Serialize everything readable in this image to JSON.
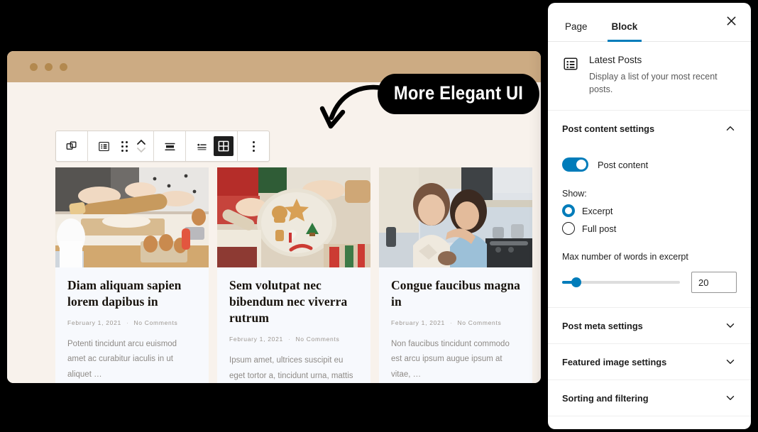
{
  "callout": {
    "text": "More Elegant UI",
    "arrow_icon": "curved-arrow-down-left-icon"
  },
  "browser": {
    "window_dots": [
      "dot-1",
      "dot-2",
      "dot-3"
    ],
    "titlebar_color": "#ccab83",
    "page_background": "#f8f2ec"
  },
  "toolbar": {
    "buttons": [
      {
        "name": "block-transform-button",
        "icon": "copy-blocks-icon"
      },
      {
        "name": "block-type-button",
        "icon": "list-view-icon"
      },
      {
        "name": "drag-handle-button",
        "icon": "drag-dots-icon"
      },
      {
        "name": "move-updown-button",
        "icon": "chevron-up-down-icon"
      },
      {
        "name": "align-button",
        "icon": "align-center-icon"
      },
      {
        "name": "list-layout-button",
        "icon": "list-layout-icon"
      },
      {
        "name": "grid-layout-button",
        "icon": "grid-layout-icon",
        "active": true
      },
      {
        "name": "more-options-button",
        "icon": "three-dots-vertical-icon"
      }
    ]
  },
  "posts": [
    {
      "title": "Diam aliquam sapien lorem dapibus in",
      "date": "February 1, 2021",
      "separator": "·",
      "comments": "No Comments",
      "excerpt": "Potenti tincidunt arcu euismod amet ac curabitur iaculis in ut aliquet …",
      "image_alt": "people-rolling-dough-baking-photo"
    },
    {
      "title": "Sem volutpat nec bibendum nec viverra rutrum",
      "date": "February 1, 2021",
      "separator": "·",
      "comments": "No Comments",
      "excerpt": "Ipsum amet, ultrices suscipit eu eget tortor a, tincidunt urna, mattis …",
      "image_alt": "decorated-christmas-cookies-plate-photo"
    },
    {
      "title": "Congue faucibus magna in",
      "date": "February 1, 2021",
      "separator": "·",
      "comments": "No Comments",
      "excerpt": "Non faucibus tincidunt commodo est arcu ipsum augue ipsum at vitae, …",
      "image_alt": "two-women-hugging-in-kitchen-photo"
    }
  ],
  "panel": {
    "tabs": [
      {
        "label": "Page",
        "active": false
      },
      {
        "label": "Block",
        "active": true
      }
    ],
    "close_icon": "close-icon",
    "accent_color": "#007cba",
    "block": {
      "icon": "latest-posts-block-icon",
      "title": "Latest Posts",
      "description": "Display a list of your most recent posts."
    },
    "sections": [
      {
        "title": "Post content settings",
        "expanded": true,
        "chevron": "chevron-up-icon"
      },
      {
        "title": "Post meta settings",
        "expanded": false,
        "chevron": "chevron-down-icon"
      },
      {
        "title": "Featured image settings",
        "expanded": false,
        "chevron": "chevron-down-icon"
      },
      {
        "title": "Sorting and filtering",
        "expanded": false,
        "chevron": "chevron-down-icon"
      }
    ],
    "post_content": {
      "toggle_label": "Post content",
      "toggle_on": true,
      "show_label": "Show:",
      "options": [
        {
          "label": "Excerpt",
          "checked": true
        },
        {
          "label": "Full post",
          "checked": false
        }
      ],
      "max_words_label": "Max number of words in excerpt",
      "max_words_value": "20",
      "slider_percent": 12
    }
  }
}
